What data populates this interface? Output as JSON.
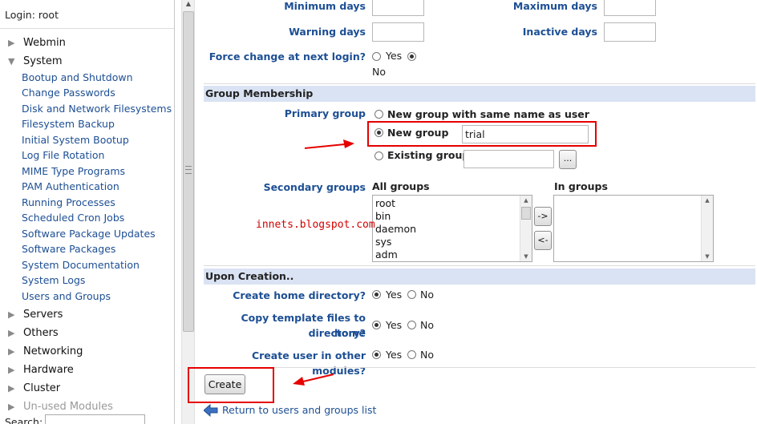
{
  "sidebar": {
    "login": "Login: root",
    "categories_top": [
      {
        "label": "Webmin",
        "expanded": false
      },
      {
        "label": "System",
        "expanded": true
      }
    ],
    "system_modules": [
      "Bootup and Shutdown",
      "Change Passwords",
      "Disk and Network Filesystems",
      "Filesystem Backup",
      "Initial System Bootup",
      "Log File Rotation",
      "MIME Type Programs",
      "PAM Authentication",
      "Running Processes",
      "Scheduled Cron Jobs",
      "Software Package Updates",
      "Software Packages",
      "System Documentation",
      "System Logs",
      "Users and Groups"
    ],
    "categories_bottom": [
      {
        "label": "Servers"
      },
      {
        "label": "Others"
      },
      {
        "label": "Networking"
      },
      {
        "label": "Hardware"
      },
      {
        "label": "Cluster"
      },
      {
        "label": "Un-used Modules"
      }
    ],
    "search_label": "Search:",
    "search_value": ""
  },
  "password": {
    "min_days_label": "Minimum days",
    "max_days_label": "Maximum days",
    "warning_days_label": "Warning days",
    "inactive_days_label": "Inactive days",
    "min_days": "",
    "max_days": "",
    "warning_days": "",
    "inactive_days": "",
    "force_change_label": "Force change at next login?",
    "yes": "Yes",
    "no": "No",
    "force_change_selected": "No"
  },
  "group_membership": {
    "heading": "Group Membership",
    "primary_group_label": "Primary group",
    "option_same_name": "New group with same name as user",
    "option_new_group": "New group",
    "new_group_value": "trial",
    "option_existing": "Existing group",
    "existing_value": "",
    "browse_button": "...",
    "primary_selected": "New group",
    "secondary_label": "Secondary groups",
    "all_groups_label": "All groups",
    "in_groups_label": "In groups",
    "all_groups": [
      "root",
      "bin",
      "daemon",
      "sys",
      "adm"
    ],
    "in_groups": [],
    "add_button": "->",
    "remove_button": "<-"
  },
  "upon_creation": {
    "heading": "Upon Creation..",
    "create_home_label": "Create home directory?",
    "copy_template_label_1": "Copy template files to home",
    "copy_template_label_2": "directory?",
    "other_modules_label": "Create user in other modules?",
    "yes": "Yes",
    "no": "No",
    "create_home_selected": "Yes",
    "copy_template_selected": "Yes",
    "other_modules_selected": "Yes"
  },
  "actions": {
    "create_button": "Create",
    "return_link": "Return to users and groups list"
  },
  "watermark": "innets.blogspot.com",
  "annotation_color": "#e60000"
}
